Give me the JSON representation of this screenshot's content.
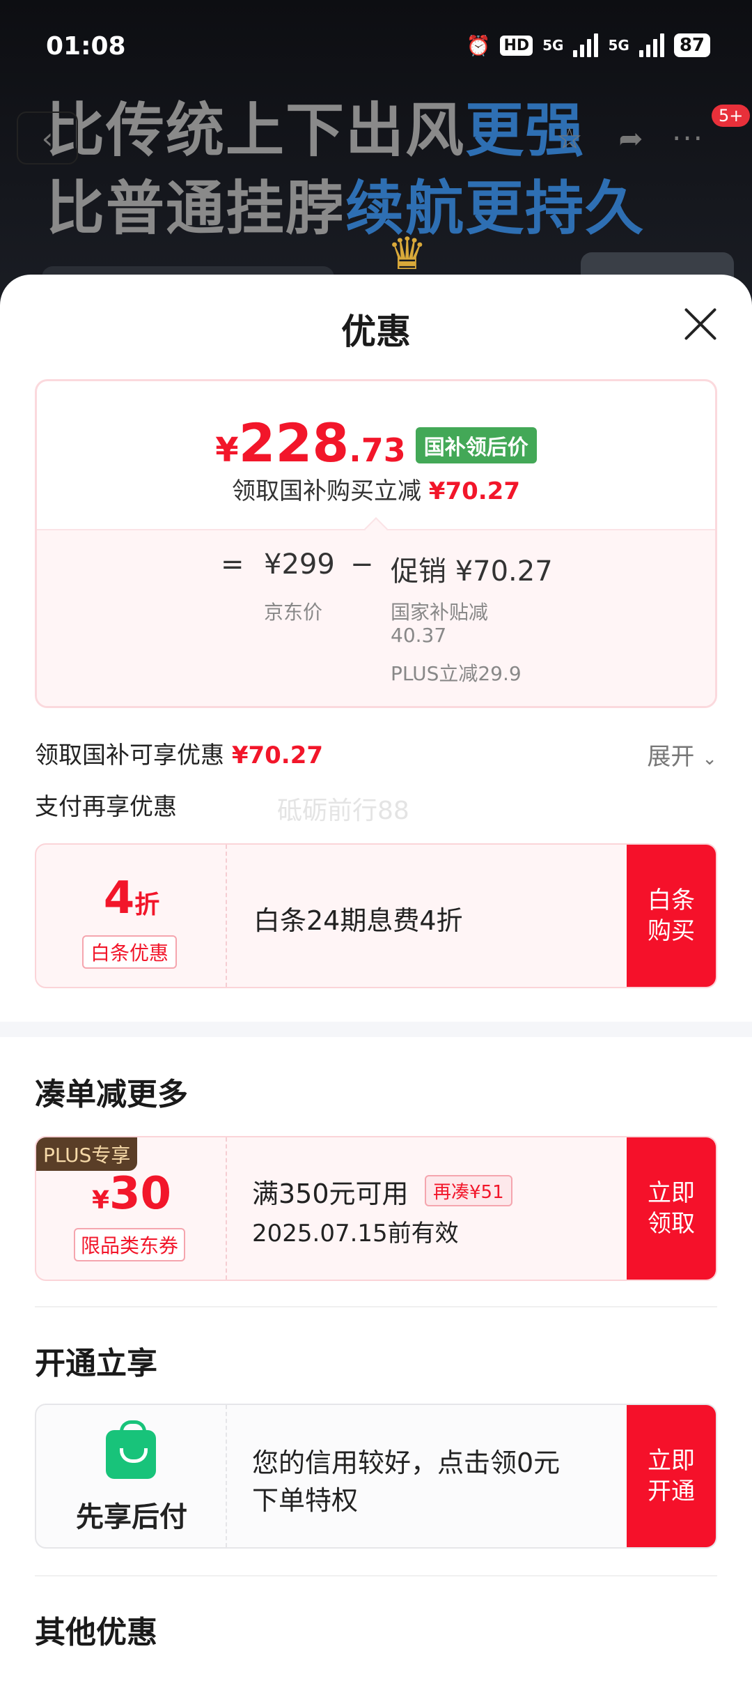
{
  "status_bar": {
    "time": "01:08",
    "hd": "HD",
    "net1": "5G",
    "net2": "5G",
    "battery": "87"
  },
  "background": {
    "line1_a": "比传统上下出风",
    "line1_b": "更强",
    "line2_a": "比普通挂脖",
    "line2_b": "续航更持久",
    "badge": "5+"
  },
  "sheet": {
    "title": "优惠",
    "price": {
      "symbol": "¥",
      "integer": "228",
      "decimal": ".73",
      "tag": "国补领后价",
      "subtitle_prefix": "领取国补购买立减",
      "subtitle_amount": "¥70.27",
      "equals": "=",
      "jd_price": "¥299",
      "jd_label": "京东价",
      "minus": "−",
      "promo": "促销 ¥70.27",
      "promo_line1": "国家补贴减",
      "promo_line2": "40.37",
      "promo_line3": "PLUS立减29.9"
    },
    "gov_label": "领取国补可享优惠",
    "gov_amount": "¥70.27",
    "expand_label": "展开",
    "pay_label": "支付再享优惠",
    "watermark": "砥砺前行88",
    "baitiao": {
      "num": "4",
      "unit": "折",
      "tag": "白条优惠",
      "text": "白条24期息费4折",
      "action": "白条购买"
    },
    "section_more": "凑单减更多",
    "coupon": {
      "plus": "PLUS专享",
      "symbol": "¥",
      "amount": "30",
      "tag": "限品类东券",
      "cond": "满350元可用",
      "add": "再凑¥51",
      "expire": "2025.07.15前有效",
      "action": "立即领取"
    },
    "section_open": "开通立享",
    "paylater": {
      "name": "先享后付",
      "line1": "您的信用较好，点击领0元",
      "line2": "下单特权",
      "action": "立即开通"
    },
    "section_other": "其他优惠"
  }
}
